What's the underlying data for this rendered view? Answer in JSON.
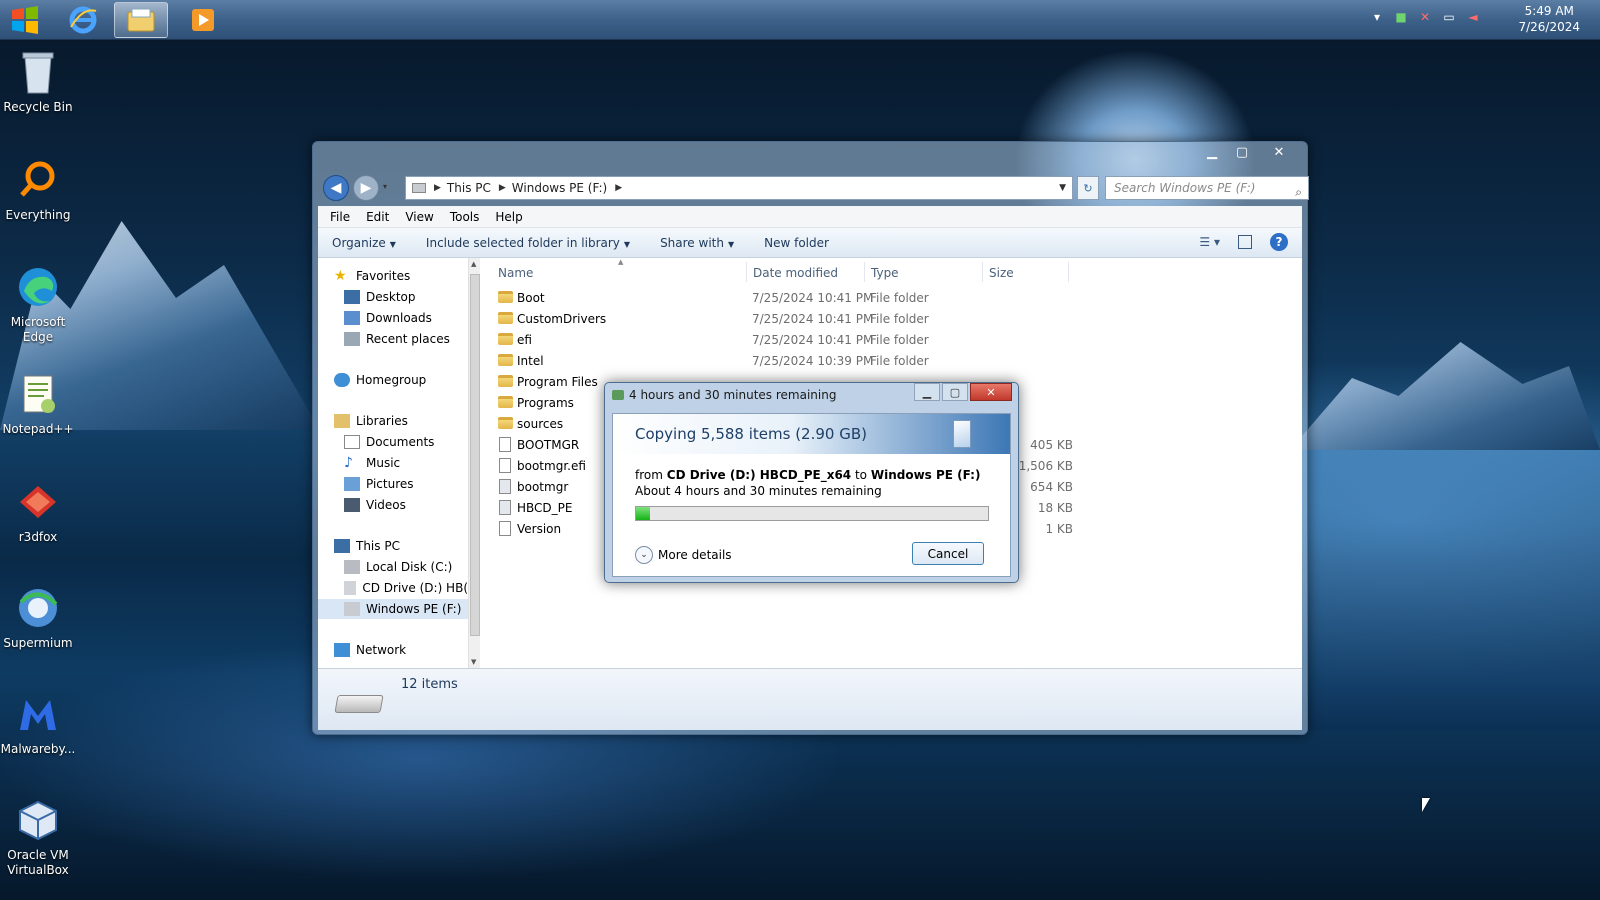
{
  "taskbar": {
    "apps": [
      {
        "name": "internet-explorer",
        "icon": "ie-icon"
      },
      {
        "name": "file-explorer",
        "icon": "folder-icon",
        "active": true
      },
      {
        "name": "media-player",
        "icon": "play-icon"
      }
    ],
    "clock": {
      "time": "5:49 AM",
      "date": "7/26/2024"
    }
  },
  "desktop": {
    "icons": [
      {
        "label": "Recycle Bin",
        "icon": "recycle-bin-icon"
      },
      {
        "label": "Everything",
        "icon": "everything-search-icon"
      },
      {
        "label": "Microsoft Edge",
        "icon": "edge-icon"
      },
      {
        "label": "Notepad++",
        "icon": "notepad-icon"
      },
      {
        "label": "r3dfox",
        "icon": "r3dfox-icon"
      },
      {
        "label": "Supermium",
        "icon": "supermium-icon"
      },
      {
        "label": "Malwareby...",
        "icon": "malwarebytes-icon"
      },
      {
        "label": "Oracle VM VirtualBox",
        "icon": "virtualbox-icon"
      }
    ]
  },
  "explorer": {
    "breadcrumb": [
      "This PC",
      "Windows PE (F:)"
    ],
    "search_placeholder": "Search Windows PE (F:)",
    "menu": [
      "File",
      "Edit",
      "View",
      "Tools",
      "Help"
    ],
    "commands": {
      "organize": "Organize",
      "include": "Include selected folder in library",
      "share": "Share with",
      "new_folder": "New folder"
    },
    "nav": {
      "favorites": "Favorites",
      "desktop": "Desktop",
      "downloads": "Downloads",
      "recent": "Recent places",
      "homegroup": "Homegroup",
      "libraries": "Libraries",
      "documents": "Documents",
      "music": "Music",
      "pictures": "Pictures",
      "videos": "Videos",
      "thispc": "This PC",
      "localdisk": "Local Disk (C:)",
      "cddrive": "CD Drive (D:) HB(",
      "winpe": "Windows PE (F:)",
      "network": "Network"
    },
    "columns": {
      "name": "Name",
      "date": "Date modified",
      "type": "Type",
      "size": "Size"
    },
    "files": [
      {
        "name": "Boot",
        "date": "7/25/2024 10:41 PM",
        "type": "File folder",
        "size": "",
        "kind": "folder"
      },
      {
        "name": "CustomDrivers",
        "date": "7/25/2024 10:41 PM",
        "type": "File folder",
        "size": "",
        "kind": "folder"
      },
      {
        "name": "efi",
        "date": "7/25/2024 10:41 PM",
        "type": "File folder",
        "size": "",
        "kind": "folder"
      },
      {
        "name": "Intel",
        "date": "7/25/2024 10:39 PM",
        "type": "File folder",
        "size": "",
        "kind": "folder"
      },
      {
        "name": "Program Files",
        "date": "",
        "type": "",
        "size": "",
        "kind": "folder"
      },
      {
        "name": "Programs",
        "date": "",
        "type": "",
        "size": "",
        "kind": "folder"
      },
      {
        "name": "sources",
        "date": "",
        "type": "",
        "size": "",
        "kind": "folder"
      },
      {
        "name": "BOOTMGR",
        "date": "",
        "type": "",
        "size": "405 KB",
        "kind": "file"
      },
      {
        "name": "bootmgr.efi",
        "date": "",
        "type": "",
        "size": "1,506 KB",
        "kind": "file"
      },
      {
        "name": "bootmgr",
        "date": "",
        "type": "",
        "size": "654 KB",
        "kind": "file"
      },
      {
        "name": "HBCD_PE",
        "date": "",
        "type": "",
        "size": "18 KB",
        "kind": "file"
      },
      {
        "name": "Version",
        "date": "",
        "type": "",
        "size": "1 KB",
        "kind": "file"
      }
    ],
    "status": {
      "items": "12 items"
    }
  },
  "copy_dialog": {
    "title": "4 hours and 30 minutes remaining",
    "heading": "Copying 5,588 items (2.90 GB)",
    "from_word": "from",
    "source": "CD Drive (D:) HBCD_PE_x64",
    "to_word": "to",
    "destination": "Windows PE (F:)",
    "remaining": "About 4 hours and 30 minutes remaining",
    "progress_fraction": 0.04,
    "more_details": "More details",
    "cancel": "Cancel"
  },
  "colors": {
    "progress_green": "#16b316",
    "accent_blue": "#3d77b5"
  }
}
